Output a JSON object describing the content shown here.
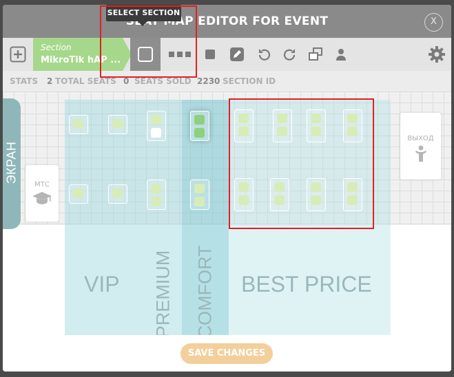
{
  "header": {
    "title": "SEAT MAP EDITOR FOR EVENT",
    "close_label": "X"
  },
  "tooltip": {
    "text": "SELECT SECTION"
  },
  "toolbar": {
    "section_label": "Section",
    "section_value": "MikroTik hAP ...",
    "icons": [
      "add-icon",
      "select-square-icon",
      "row-dots-icon",
      "solid-square-icon",
      "pencil-icon",
      "undo-icon",
      "redo-icon",
      "group-icon",
      "person-icon",
      "gear-icon"
    ]
  },
  "stats": {
    "label": "STATS",
    "total_seats_num": "2",
    "total_seats_label": "TOTAL SEATS",
    "seats_sold_num": "0",
    "seats_sold_label": "SEATS SOLD",
    "section_id_num": "2230",
    "section_id_label": "SECTION ID"
  },
  "canvas": {
    "screen_label": "ЭКРАН",
    "left_card_label": "МТС",
    "right_card_label": "ВЫХОД",
    "zones": {
      "vip": "VIP",
      "premium": "PREMIUM",
      "comfort": "COMFORT",
      "best": "BEST PRICE"
    }
  },
  "footer": {
    "save_label": "SAVE CHANGES"
  },
  "colors": {
    "header": "#8a8a8a",
    "section_chip": "#a5d88a",
    "save_button": "#f3cf9b",
    "highlight": "#e02020"
  }
}
